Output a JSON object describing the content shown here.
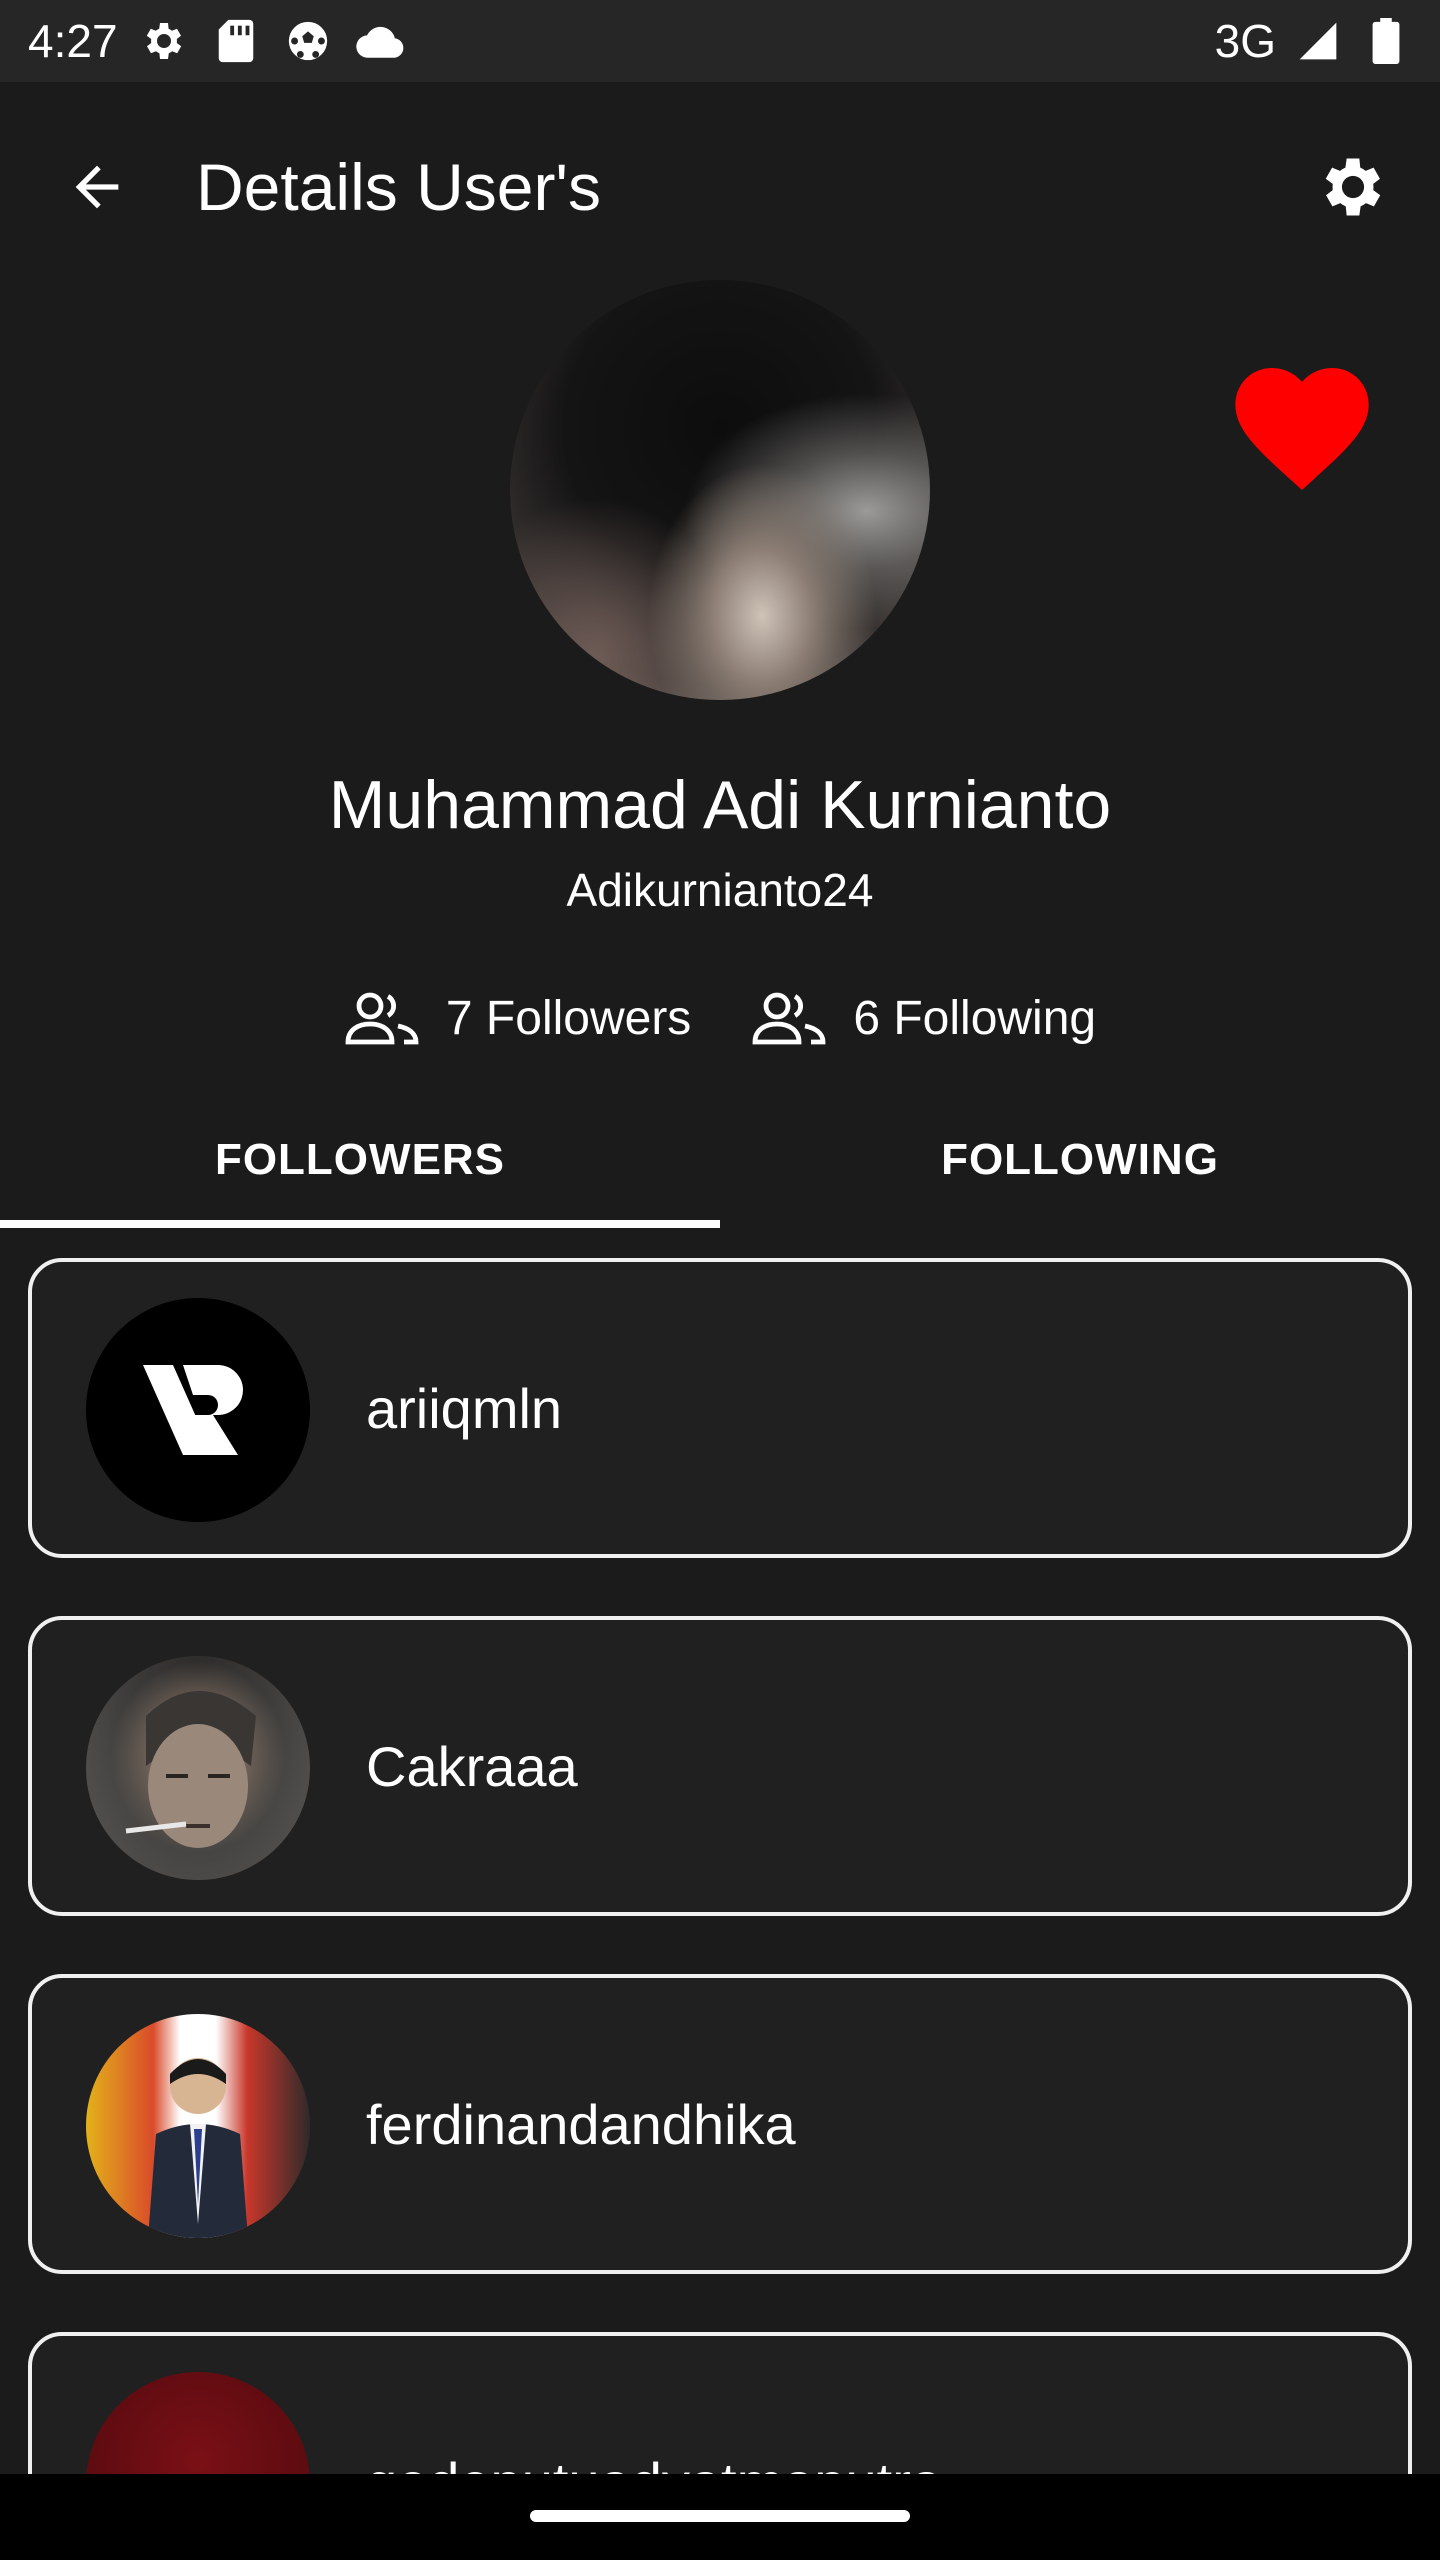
{
  "status_bar": {
    "time": "4:27",
    "network": "3G",
    "icons_left": [
      "settings-gear-icon",
      "sd-card-icon",
      "soccer-ball-icon",
      "cloud-icon"
    ],
    "icons_right": [
      "signal-icon",
      "battery-icon"
    ]
  },
  "app_bar": {
    "title": "Details User's",
    "back_icon": "arrow-back-icon",
    "settings_icon": "gear-icon"
  },
  "profile": {
    "name": "Muhammad Adi Kurnianto",
    "username": "Adikurnianto24",
    "favorite_icon": "heart-icon",
    "favorite_color": "#ff0000",
    "followers_label": "7 Followers",
    "following_label": "6 Following"
  },
  "tabs": [
    {
      "label": "FOLLOWERS",
      "selected": true
    },
    {
      "label": "FOLLOWING",
      "selected": false
    }
  ],
  "users": [
    {
      "login": "ariiqmln"
    },
    {
      "login": "Cakraaa"
    },
    {
      "login": "ferdinandandhika"
    },
    {
      "login": "gedeputuadyatmaputra"
    }
  ],
  "colors": {
    "background": "#1b1b1b",
    "status_bar": "#262626",
    "card_border": "#f0f0f0",
    "accent": "#ffffff"
  }
}
